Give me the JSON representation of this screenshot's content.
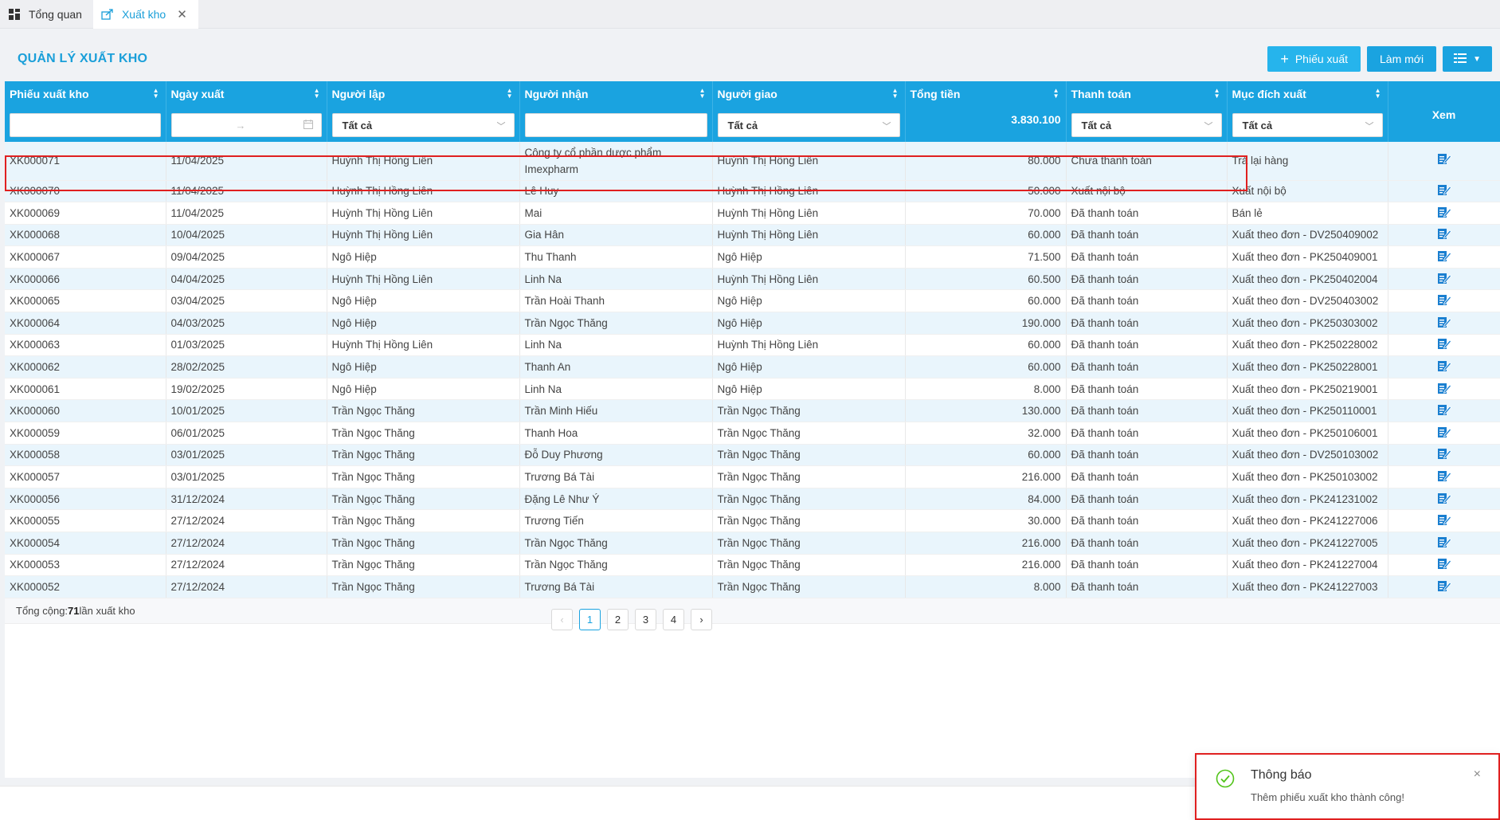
{
  "tabs": [
    {
      "label": "Tổng quan"
    },
    {
      "label": "Xuất kho"
    }
  ],
  "panel": {
    "title": "QUẢN LÝ XUẤT KHO",
    "add_label": "Phiếu xuất",
    "refresh_label": "Làm mới"
  },
  "columns": [
    "Phiếu xuất kho",
    "Ngày xuất",
    "Người lập",
    "Người nhận",
    "Người giao",
    "Tổng tiền",
    "Thanh toán",
    "Mục đích xuất",
    "Xem"
  ],
  "filters": {
    "nguoi_lap": "Tất cả",
    "nguoi_giao": "Tất cả",
    "thanh_toan": "Tất cả",
    "muc_dich": "Tất cả",
    "tong_tien": "3.830.100",
    "date_sep": "→"
  },
  "rows": [
    [
      "XK000071",
      "11/04/2025",
      "Huỳnh Thị Hồng Liên",
      "Công ty cổ phần dược phẩm Imexpharm",
      "Huỳnh Thị Hồng Liên",
      "80.000",
      "Chưa thanh toán",
      "Trả lại hàng"
    ],
    [
      "XK000070",
      "11/04/2025",
      "Huỳnh Thị Hồng Liên",
      "Lê Huy",
      "Huỳnh Thị Hồng Liên",
      "50.000",
      "Xuất nội bộ",
      "Xuất nội bộ"
    ],
    [
      "XK000069",
      "11/04/2025",
      "Huỳnh Thị Hồng Liên",
      "Mai",
      "Huỳnh Thị Hồng Liên",
      "70.000",
      "Đã thanh toán",
      "Bán lẻ"
    ],
    [
      "XK000068",
      "10/04/2025",
      "Huỳnh Thị Hồng Liên",
      "Gia Hân",
      "Huỳnh Thị Hồng Liên",
      "60.000",
      "Đã thanh toán",
      "Xuất theo đơn - DV250409002"
    ],
    [
      "XK000067",
      "09/04/2025",
      "Ngô Hiệp",
      "Thu Thanh",
      "Ngô Hiệp",
      "71.500",
      "Đã thanh toán",
      "Xuất theo đơn - PK250409001"
    ],
    [
      "XK000066",
      "04/04/2025",
      "Huỳnh Thị Hồng Liên",
      "Linh Na",
      "Huỳnh Thị Hồng Liên",
      "60.500",
      "Đã thanh toán",
      "Xuất theo đơn - PK250402004"
    ],
    [
      "XK000065",
      "03/04/2025",
      "Ngô Hiệp",
      "Trần Hoài Thanh",
      "Ngô Hiệp",
      "60.000",
      "Đã thanh toán",
      "Xuất theo đơn - DV250403002"
    ],
    [
      "XK000064",
      "04/03/2025",
      "Ngô Hiệp",
      "Trần Ngọc Thăng",
      "Ngô Hiệp",
      "190.000",
      "Đã thanh toán",
      "Xuất theo đơn - PK250303002"
    ],
    [
      "XK000063",
      "01/03/2025",
      "Huỳnh Thị Hồng Liên",
      "Linh Na",
      "Huỳnh Thị Hồng Liên",
      "60.000",
      "Đã thanh toán",
      "Xuất theo đơn - PK250228002"
    ],
    [
      "XK000062",
      "28/02/2025",
      "Ngô Hiệp",
      "Thanh An",
      "Ngô Hiệp",
      "60.000",
      "Đã thanh toán",
      "Xuất theo đơn - PK250228001"
    ],
    [
      "XK000061",
      "19/02/2025",
      "Ngô Hiệp",
      "Linh Na",
      "Ngô Hiệp",
      "8.000",
      "Đã thanh toán",
      "Xuất theo đơn - PK250219001"
    ],
    [
      "XK000060",
      "10/01/2025",
      "Trần Ngọc Thăng",
      "Trần Minh Hiếu",
      "Trần Ngọc Thăng",
      "130.000",
      "Đã thanh toán",
      "Xuất theo đơn - PK250110001"
    ],
    [
      "XK000059",
      "06/01/2025",
      "Trần Ngọc Thăng",
      "Thanh Hoa",
      "Trần Ngọc Thăng",
      "32.000",
      "Đã thanh toán",
      "Xuất theo đơn - PK250106001"
    ],
    [
      "XK000058",
      "03/01/2025",
      "Trần Ngọc Thăng",
      "Đỗ Duy Phương",
      "Trần Ngọc Thăng",
      "60.000",
      "Đã thanh toán",
      "Xuất theo đơn - DV250103002"
    ],
    [
      "XK000057",
      "03/01/2025",
      "Trần Ngọc Thăng",
      "Trương Bá Tài",
      "Trần Ngọc Thăng",
      "216.000",
      "Đã thanh toán",
      "Xuất theo đơn - PK250103002"
    ],
    [
      "XK000056",
      "31/12/2024",
      "Trần Ngọc Thăng",
      "Đặng Lê Như Ý",
      "Trần Ngọc Thăng",
      "84.000",
      "Đã thanh toán",
      "Xuất theo đơn - PK241231002"
    ],
    [
      "XK000055",
      "27/12/2024",
      "Trần Ngọc Thăng",
      "Trương Tiến",
      "Trần Ngọc Thăng",
      "30.000",
      "Đã thanh toán",
      "Xuất theo đơn - PK241227006"
    ],
    [
      "XK000054",
      "27/12/2024",
      "Trần Ngọc Thăng",
      "Trần Ngọc Thăng",
      "Trần Ngọc Thăng",
      "216.000",
      "Đã thanh toán",
      "Xuất theo đơn - PK241227005"
    ],
    [
      "XK000053",
      "27/12/2024",
      "Trần Ngọc Thăng",
      "Trần Ngọc Thăng",
      "Trần Ngọc Thăng",
      "216.000",
      "Đã thanh toán",
      "Xuất theo đơn - PK241227004"
    ],
    [
      "XK000052",
      "27/12/2024",
      "Trần Ngọc Thăng",
      "Trương Bá Tài",
      "Trần Ngọc Thăng",
      "8.000",
      "Đã thanh toán",
      "Xuất theo đơn - PK241227003"
    ]
  ],
  "footer": {
    "prefix": "Tổng cộng: ",
    "count": "71",
    "suffix": " lần xuất kho"
  },
  "pagination": {
    "pages": [
      "1",
      "2",
      "3",
      "4"
    ],
    "current": "1",
    "prev": "‹",
    "next": "›"
  },
  "toast": {
    "title": "Thông báo",
    "message": "Thêm phiếu xuất kho thành công!",
    "close": "×"
  },
  "colors": {
    "accent": "#1aa3e0",
    "highlight": "#e02020",
    "success": "#52c41a"
  }
}
